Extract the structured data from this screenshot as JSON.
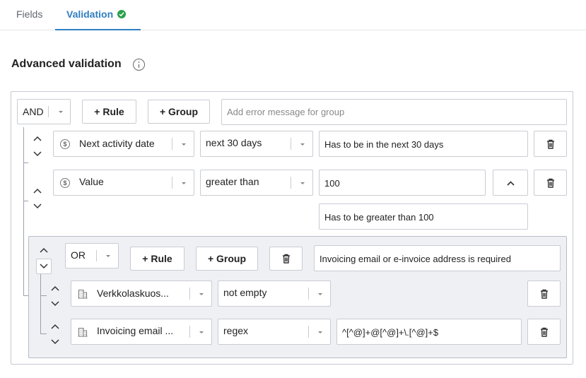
{
  "tabs": [
    {
      "label": "Fields"
    },
    {
      "label": "Validation"
    }
  ],
  "section": {
    "title": "Advanced validation"
  },
  "root_group": {
    "operator": "AND",
    "add_rule_label": "+ Rule",
    "add_group_label": "+ Group",
    "error_placeholder": "Add error message for group",
    "rules": [
      {
        "field": "Next activity date",
        "field_icon": "dollar-circle-icon",
        "condition": "next 30 days",
        "message": "Has to be in the next 30 days"
      },
      {
        "field": "Value",
        "field_icon": "dollar-circle-icon",
        "condition": "greater than",
        "value": "100",
        "message": "Has to be greater than 100"
      }
    ]
  },
  "sub_group": {
    "operator": "OR",
    "add_rule_label": "+ Rule",
    "add_group_label": "+ Group",
    "error_message": "Invoicing email or e-invoice address is required",
    "rules": [
      {
        "field": "Verkkolaskuos...",
        "field_icon": "building-icon",
        "condition": "not empty"
      },
      {
        "field": "Invoicing email ...",
        "field_icon": "building-icon",
        "condition": "regex",
        "value": "^[^@]+@[^@]+\\.[^@]+$"
      }
    ]
  },
  "colors": {
    "accent": "#2f7ec0",
    "success": "#2aa04a",
    "group_bg": "#eef0f4"
  }
}
